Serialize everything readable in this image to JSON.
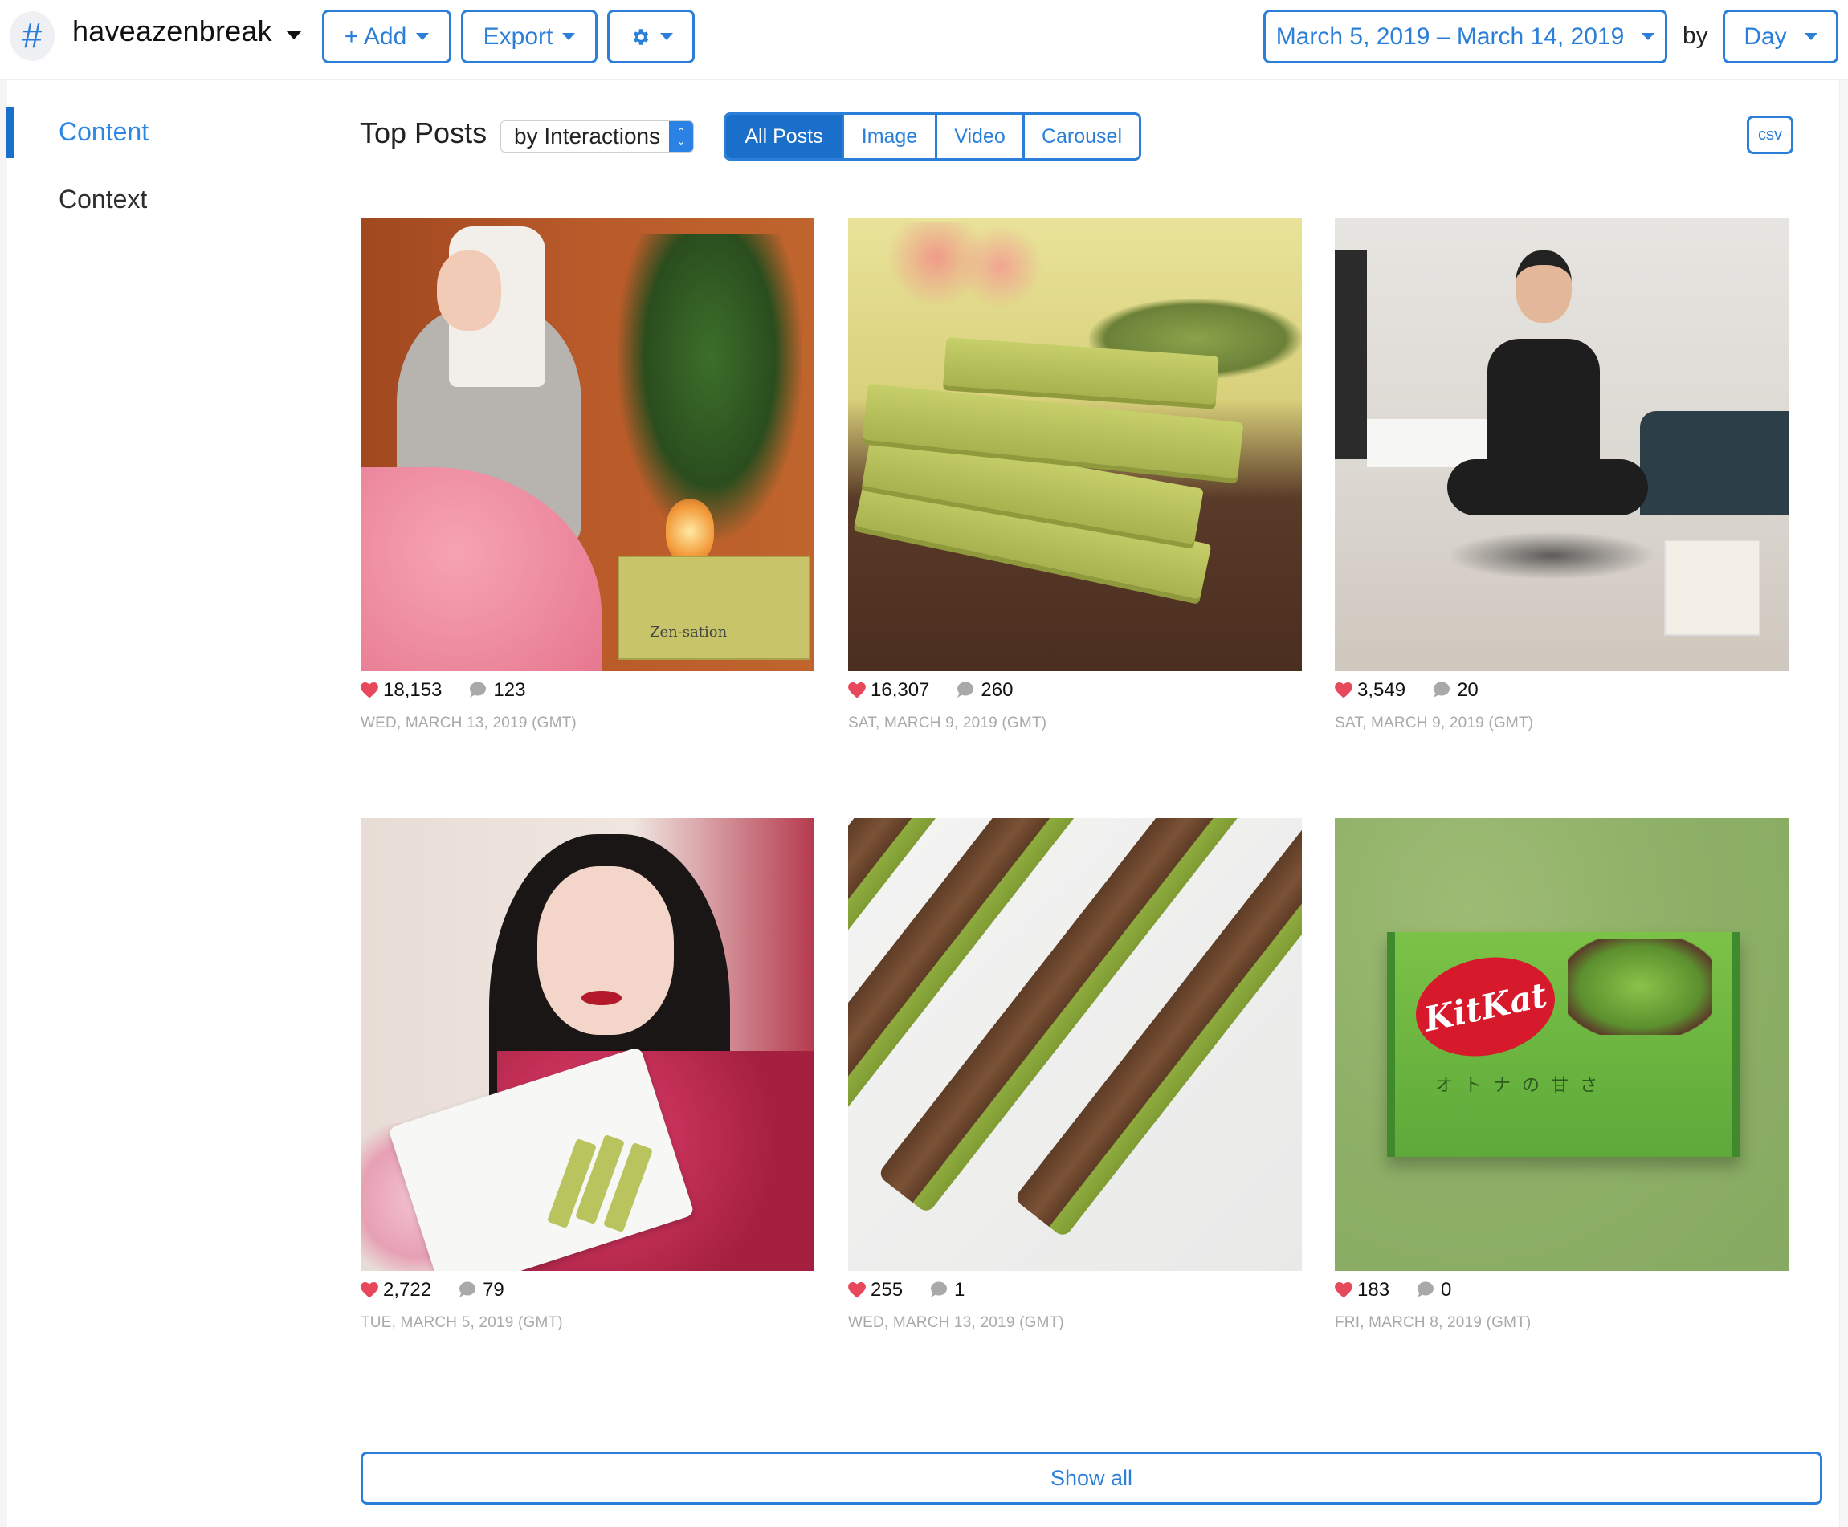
{
  "header": {
    "account_icon": "hashtag-icon",
    "account_symbol": "#",
    "account_name": "haveazenbreak",
    "add_label": "+ Add",
    "export_label": "Export",
    "settings_icon": "gear-icon",
    "date_range": "March 5, 2019 – March 14, 2019",
    "by_label": "by",
    "granularity": "Day"
  },
  "sidebar": {
    "items": [
      {
        "label": "Content",
        "active": true
      },
      {
        "label": "Context",
        "active": false
      }
    ]
  },
  "toolbar": {
    "title": "Top Posts",
    "sort_by": "by Interactions",
    "filters": [
      {
        "label": "All Posts",
        "active": true
      },
      {
        "label": "Image",
        "active": false
      },
      {
        "label": "Video",
        "active": false
      },
      {
        "label": "Carousel",
        "active": false
      }
    ],
    "csv_label": "csv"
  },
  "posts": [
    {
      "likes": "18,153",
      "comments": "123",
      "date": "WED, MARCH 13, 2019 (GMT)",
      "image": "woman in bathrobe with KitKat Matcha Zen-sation box"
    },
    {
      "likes": "16,307",
      "comments": "260",
      "date": "SAT, MARCH 9, 2019 (GMT)",
      "image": "stack of green matcha KitKat bars"
    },
    {
      "likes": "3,549",
      "comments": "20",
      "date": "SAT, MARCH 9, 2019 (GMT)",
      "image": "man meditating levitating with KitKat box"
    },
    {
      "likes": "2,722",
      "comments": "79",
      "date": "TUE, MARCH 5, 2019 (GMT)",
      "image": "woman in kimono holding plate of matcha KitKat"
    },
    {
      "likes": "255",
      "comments": "1",
      "date": "WED, MARCH 13, 2019 (GMT)",
      "image": "matcha KitKat bars with chocolate nut topping"
    },
    {
      "likes": "183",
      "comments": "0",
      "date": "FRI, MARCH 8, 2019 (GMT)",
      "image": "KitKat matcha mini package on green background"
    }
  ],
  "pack_brand": "KitKat",
  "pack_text": "オトナの甘さ",
  "box_text": "Zen-sation",
  "show_all_label": "Show all",
  "colors": {
    "accent": "#2b7fd9",
    "active_fill": "#1a6fcb",
    "heart": "#e8485b",
    "comment": "#a9a9a9",
    "date_text": "#a9a9a9"
  }
}
